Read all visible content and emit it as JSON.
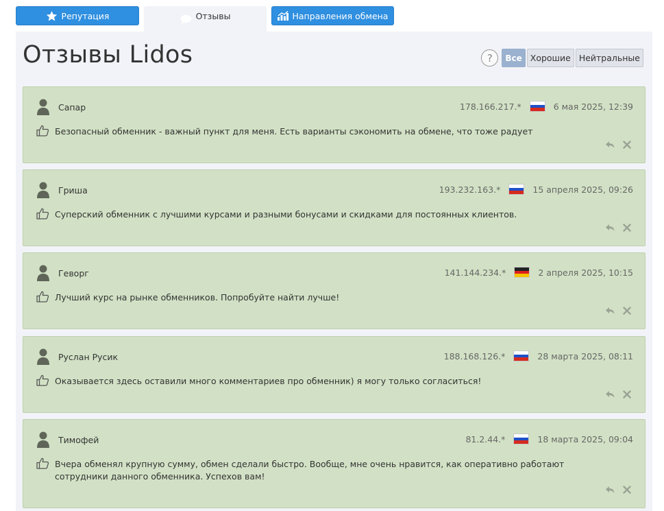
{
  "tabs": {
    "reputation": "Репутация",
    "reviews": "Отзывы",
    "directions": "Направления обмена"
  },
  "page": {
    "title": "Отзывы Lidos"
  },
  "filters": {
    "help": "?",
    "all": "Все",
    "good": "Хорошие",
    "neutral": "Нейтральные"
  },
  "colors": {
    "accent": "#2f8fe0",
    "review_bg": "#d2e1c5",
    "filter_active": "#9ab1cf"
  },
  "reviews": [
    {
      "author": "Сапар",
      "ip": "178.166.217.*",
      "flag": "russia",
      "date": "6 мая 2025, 12:39",
      "text": "Безопасный обменник - важный пункт для меня. Есть варианты сэкономить на обмене, что тоже радует"
    },
    {
      "author": "Гриша",
      "ip": "193.232.163.*",
      "flag": "russia",
      "date": "15 апреля 2025, 09:26",
      "text": "Суперский обменник с лучшими курсами и разными бонусами и скидками для постоянных клиентов."
    },
    {
      "author": "Геворг",
      "ip": "141.144.234.*",
      "flag": "germany",
      "date": "2 апреля 2025, 10:15",
      "text": "Лучший курс на рынке обменников. Попробуйте найти лучше!"
    },
    {
      "author": "Руслан Русик",
      "ip": "188.168.126.*",
      "flag": "russia",
      "date": "28 марта 2025, 08:11",
      "text": "Оказывается здесь оставили много комментариев про обменник) я могу только согласиться!"
    },
    {
      "author": "Тимофей",
      "ip": "81.2.44.*",
      "flag": "russia",
      "date": "18 марта 2025, 09:04",
      "text": "Вчера обменял крупную сумму, обмен сделали быстро. Вообще, мне очень нравится, как оперативно работают сотрудники данного обменника. Успехов вам!"
    }
  ]
}
